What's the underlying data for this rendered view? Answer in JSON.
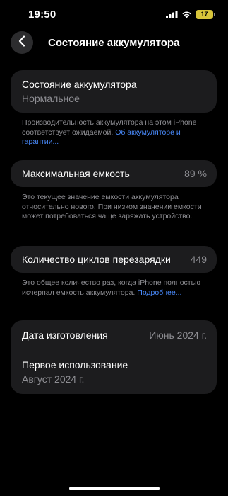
{
  "status_bar": {
    "time": "19:50",
    "battery_level": "17",
    "battery_color": "#d8c53a"
  },
  "nav": {
    "back_icon": "chevron-left-icon",
    "title": "Состояние аккумулятора"
  },
  "battery_health": {
    "label": "Состояние аккумулятора",
    "value": "Нормальное",
    "footnote_text": "Производительность аккумулятора на этом iPhone соответствует ожидаемой. ",
    "footnote_link": "Об аккумуляторе и гарантии..."
  },
  "max_capacity": {
    "label": "Максимальная емкость",
    "value": "89 %",
    "footnote": "Это текущее значение емкости аккумулятора относительно нового. При низком значении емкости может потребоваться чаще заряжать устройство."
  },
  "cycle_count": {
    "label": "Количество циклов перезарядки",
    "value": "449",
    "footnote_text": "Это общее количество раз, когда iPhone полностью исчерпал емкость аккумулятора. ",
    "footnote_link": "Подробнее..."
  },
  "dates": {
    "manufacture_label": "Дата изготовления",
    "manufacture_value": "Июнь 2024 г.",
    "first_use_label": "Первое использование",
    "first_use_value": "Август 2024 г."
  },
  "colors": {
    "background": "#000000",
    "card": "#1c1c1e",
    "secondary_text": "#8e8e93",
    "link": "#4a8cff"
  }
}
